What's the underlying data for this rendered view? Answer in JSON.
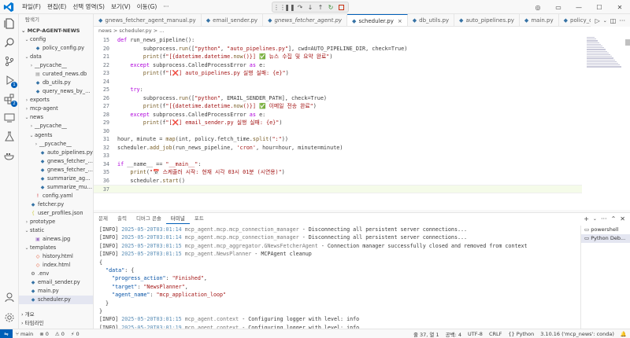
{
  "menu": [
    "파일(F)",
    "편집(E)",
    "선택 영역(S)",
    "보기(V)",
    "이동(G)",
    "···"
  ],
  "sidebar": {
    "title": "탐색기",
    "root": "MCP-AGENT-NEWS",
    "tree": [
      {
        "label": "config",
        "chev": "⌄",
        "indent": 1,
        "icon": ""
      },
      {
        "label": "policy_config.py",
        "chev": "",
        "indent": 2,
        "icon": "py"
      },
      {
        "label": "data",
        "chev": "⌄",
        "indent": 1,
        "icon": ""
      },
      {
        "label": "__pycache__",
        "chev": "›",
        "indent": 2,
        "icon": ""
      },
      {
        "label": "curated_news.db",
        "chev": "",
        "indent": 2,
        "icon": "db"
      },
      {
        "label": "db_utils.py",
        "chev": "",
        "indent": 2,
        "icon": "py"
      },
      {
        "label": "query_news_by_keywo...",
        "chev": "",
        "indent": 2,
        "icon": "py"
      },
      {
        "label": "exports",
        "chev": "›",
        "indent": 1,
        "icon": ""
      },
      {
        "label": "mcp-agent",
        "chev": "›",
        "indent": 1,
        "icon": ""
      },
      {
        "label": "news",
        "chev": "⌄",
        "indent": 1,
        "icon": ""
      },
      {
        "label": "__pycache__",
        "chev": "›",
        "indent": 2,
        "icon": ""
      },
      {
        "label": "agents",
        "chev": "⌄",
        "indent": 2,
        "icon": ""
      },
      {
        "label": "__pycache__",
        "chev": "›",
        "indent": 3,
        "icon": ""
      },
      {
        "label": "auto_pipelines.py",
        "chev": "",
        "indent": 3,
        "icon": "py"
      },
      {
        "label": "gnews_fetcher_agent...",
        "chev": "",
        "indent": 3,
        "icon": "py"
      },
      {
        "label": "gnews_fetcher_agent...",
        "chev": "",
        "indent": 3,
        "icon": "py"
      },
      {
        "label": "summarize_agent_m...",
        "chev": "",
        "indent": 3,
        "icon": "py"
      },
      {
        "label": "summarize_multimod...",
        "chev": "",
        "indent": 3,
        "icon": "py"
      },
      {
        "label": "config.yaml",
        "chev": "",
        "indent": 2,
        "icon": "yaml"
      },
      {
        "label": "fetcher.py",
        "chev": "",
        "indent": 1,
        "icon": "py"
      },
      {
        "label": "user_profiles.json",
        "chev": "",
        "indent": 1,
        "icon": "json"
      },
      {
        "label": "prototype",
        "chev": "›",
        "indent": 1,
        "icon": ""
      },
      {
        "label": "static",
        "chev": "⌄",
        "indent": 1,
        "icon": ""
      },
      {
        "label": "ainews.jpg",
        "chev": "",
        "indent": 2,
        "icon": "img"
      },
      {
        "label": "templates",
        "chev": "⌄",
        "indent": 1,
        "icon": ""
      },
      {
        "label": "history.html",
        "chev": "",
        "indent": 2,
        "icon": "html"
      },
      {
        "label": "index.html",
        "chev": "",
        "indent": 2,
        "icon": "html"
      },
      {
        "label": ".env",
        "chev": "",
        "indent": 1,
        "icon": "env"
      },
      {
        "label": "email_sender.py",
        "chev": "",
        "indent": 1,
        "icon": "py"
      },
      {
        "label": "main.py",
        "chev": "",
        "indent": 1,
        "icon": "py"
      },
      {
        "label": "scheduler.py",
        "chev": "",
        "indent": 1,
        "icon": "py",
        "active": true
      }
    ],
    "outline": "개요",
    "timeline": "타임라인"
  },
  "tabs": [
    {
      "label": "gnews_fetcher_agent_manual.py",
      "italic": false
    },
    {
      "label": "email_sender.py",
      "italic": false
    },
    {
      "label": "gnews_fetcher_agent.py",
      "italic": true
    },
    {
      "label": "scheduler.py",
      "active": true,
      "close": "×"
    },
    {
      "label": "db_utils.py",
      "italic": false
    },
    {
      "label": "auto_pipelines.py",
      "italic": false
    },
    {
      "label": "main.py",
      "italic": false
    },
    {
      "label": "policy_config.py",
      "italic": false
    }
  ],
  "breadcrumb": "news > scheduler.py > ...",
  "code": [
    {
      "n": "15",
      "t": "def run_news_pipeline():"
    },
    {
      "n": "20",
      "t": "        subprocess.run([\"python\", \"auto_pipelines.py\"], cwd=AUTO_PIPELINE_DIR, check=True)"
    },
    {
      "n": "21",
      "t": "        print(f\"[{datetime.datetime.now()}] ✅ 뉴스 수집 및 요약 완료\")"
    },
    {
      "n": "22",
      "t": "    except subprocess.CalledProcessError as e:"
    },
    {
      "n": "23",
      "t": "        print(f\"[❌] auto_pipelines.py 실행 실패: {e}\")"
    },
    {
      "n": "24",
      "t": ""
    },
    {
      "n": "25",
      "t": "    try:"
    },
    {
      "n": "26",
      "t": "        subprocess.run([\"python\", EMAIL_SENDER_PATH], check=True)"
    },
    {
      "n": "27",
      "t": "        print(f\"[{datetime.datetime.now()}] ✅ 이메일 전송 완료\")"
    },
    {
      "n": "28",
      "t": "    except subprocess.CalledProcessError as e:"
    },
    {
      "n": "29",
      "t": "        print(f\"[❌] email_sender.py 실행 실패: {e}\")"
    },
    {
      "n": "30",
      "t": ""
    },
    {
      "n": "31",
      "t": "hour, minute = map(int, policy.fetch_time.split(\":\"))"
    },
    {
      "n": "32",
      "t": "scheduler.add_job(run_news_pipeline, 'cron', hour=hour, minute=minute)"
    },
    {
      "n": "33",
      "t": ""
    },
    {
      "n": "34",
      "t": "if __name__ == \"__main__\":"
    },
    {
      "n": "35",
      "t": "    print(\"📅 스케줄러 시작: 현재 시각 03시 01분 (시연용)\")"
    },
    {
      "n": "36",
      "t": "    scheduler.start()"
    },
    {
      "n": "37",
      "t": "",
      "current": true
    }
  ],
  "panel": {
    "tabs": [
      "문제",
      "출력",
      "디버그 콘솔",
      "터미널",
      "포트"
    ],
    "active_tab": "터미널",
    "terminals": [
      "powershell",
      "Python Deb..."
    ],
    "lines": [
      "[INFO] 2025-05-20T03:01:14 mcp_agent.mcp.mcp_connection_manager - Disconnecting all persistent server connections...",
      "[INFO] 2025-05-20T03:01:14 mcp_agent.mcp.mcp_connection_manager - Disconnecting all persistent server connections...",
      "[INFO] 2025-05-20T03:01:15 mcp_agent.mcp_aggregator.GNewsFetcherAgent - Connection manager successfully closed and removed from context",
      "[INFO] 2025-05-20T03:01:15 mcp_agent.NewsPlanner - MCPAgent cleanup",
      "{",
      "  \"data\": {",
      "    \"progress_action\": \"Finished\",",
      "    \"target\": \"NewsPlanner\",",
      "    \"agent_name\": \"mcp_application_loop\"",
      "  }",
      "}",
      "[INFO] 2025-05-20T03:01:15 mcp_agent.context - Configuring logger with level: info",
      "[INFO] 2025-05-20T03:01:19 mcp_agent.context - Configuring logger with level: info",
      "[INFO] 2025-05-20T03:01:32 mcp_agent.context - Configuring logger with level: info",
      ""
    ]
  },
  "status": {
    "branch": "main",
    "errors": "⊗ 0",
    "warnings": "⚠ 0",
    "ports": "⚡ 0",
    "position": "줄 37, 열 1",
    "spaces": "공백: 4",
    "encoding": "UTF-8",
    "eol": "CRLF",
    "language": "Python",
    "interpreter": "3.10.16 ('mcp_news': conda)"
  }
}
